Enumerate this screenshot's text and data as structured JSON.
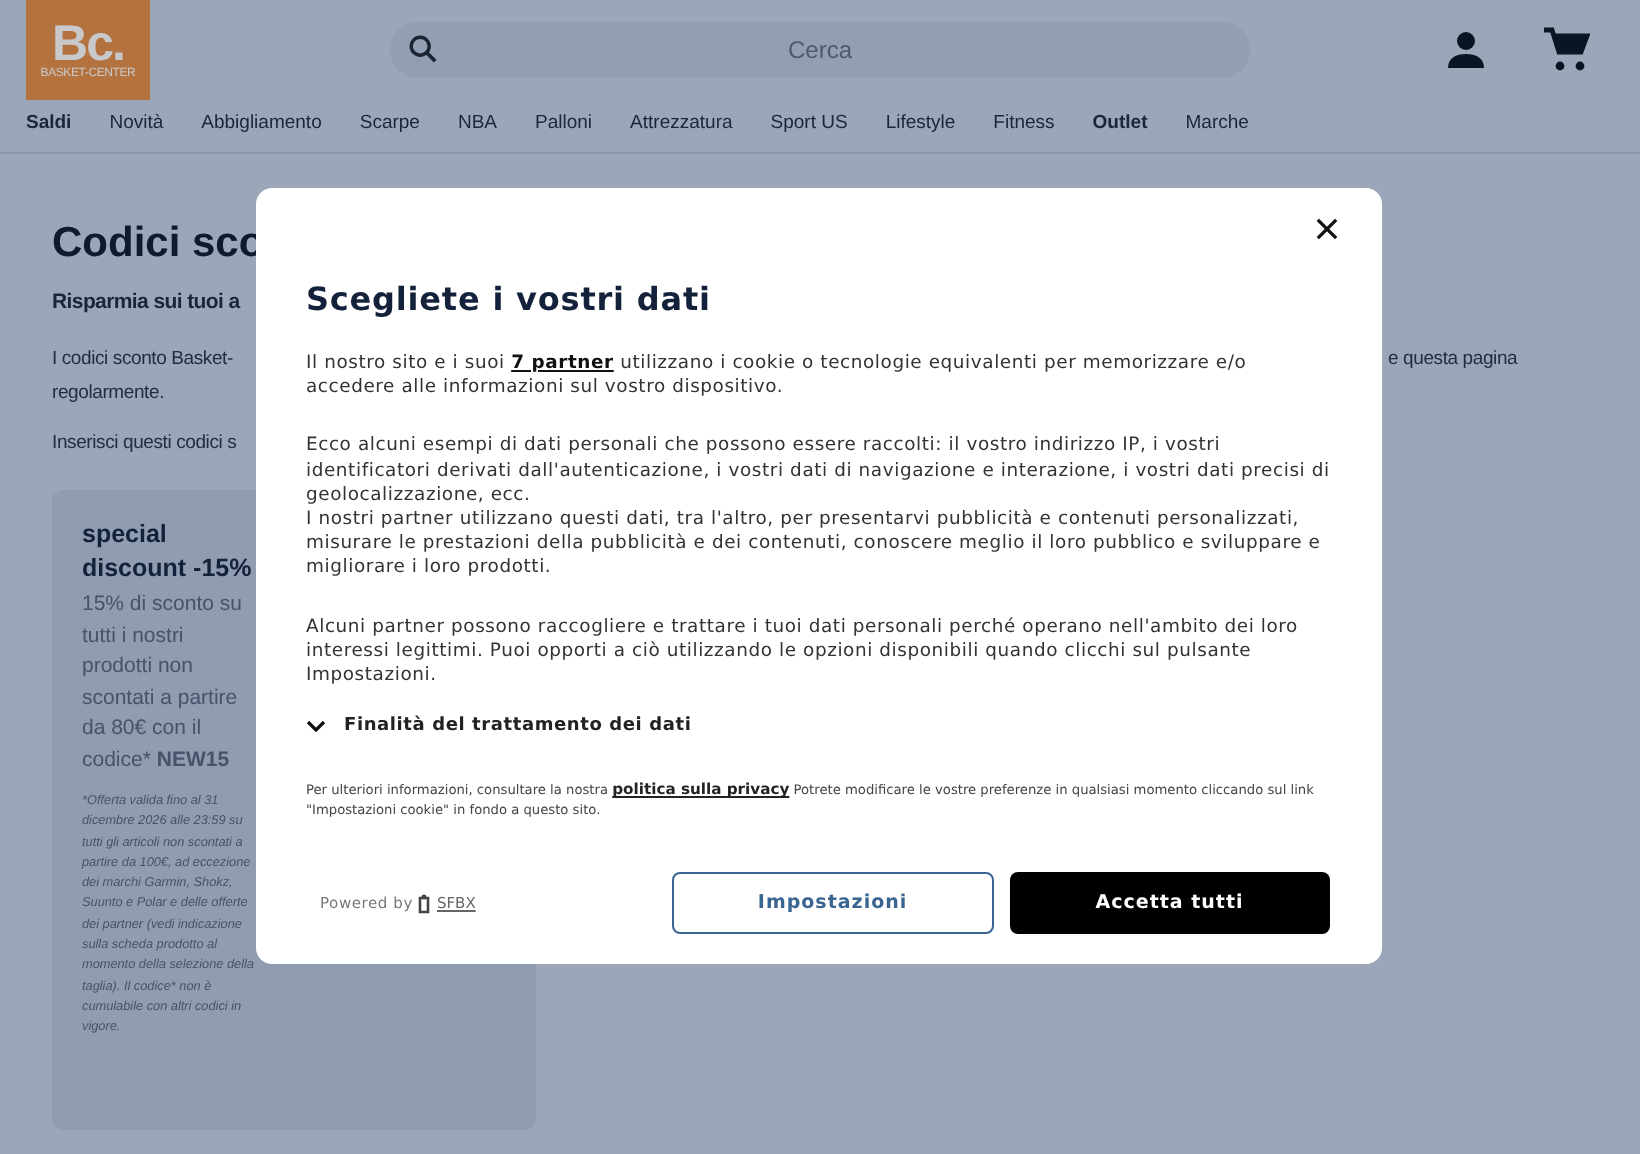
{
  "header": {
    "logo": {
      "mark": "Bc.",
      "name": "BASKET-CENTER"
    },
    "search": {
      "placeholder": "Cerca"
    }
  },
  "nav": [
    {
      "label": "Saldi",
      "emphasized": true
    },
    {
      "label": "Novità",
      "emphasized": false
    },
    {
      "label": "Abbigliamento",
      "emphasized": false
    },
    {
      "label": "Scarpe",
      "emphasized": false
    },
    {
      "label": "NBA",
      "emphasized": false
    },
    {
      "label": "Palloni",
      "emphasized": false
    },
    {
      "label": "Attrezzatura",
      "emphasized": false
    },
    {
      "label": "Sport US",
      "emphasized": false
    },
    {
      "label": "Lifestyle",
      "emphasized": false
    },
    {
      "label": "Fitness",
      "emphasized": false
    },
    {
      "label": "Outlet",
      "emphasized": true
    },
    {
      "label": "Marche",
      "emphasized": false
    }
  ],
  "page": {
    "title": "Codici sco",
    "subtitle": "Risparmia sui tuoi a",
    "intro_left": "I codici sconto Basket-",
    "intro_right": "e questa pagina",
    "intro_line2": "regolarmente.",
    "instruction": "Inserisci questi codici s",
    "card": {
      "title": "special discount -15%",
      "text": "15% di sconto su tutti i nostri prodotti non scontati a partire da 80€ con il codice* **NEW15**",
      "note": "*Offerta valida fino al 31 dicembre 2026 alle 23:59 su tutti gli articoli non scontati a partire da 100€, ad eccezione dei marchi Garmin, Shokz, Suunto e Polar e delle offerte dei partner (vedi indicazione sulla scheda prodotto al momento della selezione della taglia). Il codice* non è cumulabile con altri codici in vigore."
    }
  },
  "consent": {
    "title": "Scegliete i vostri dati",
    "intro": {
      "before": "Il nostro sito e i suoi ",
      "link": "7 partner",
      "after": " utilizzano i cookie o tecnologie equivalenti per memorizzare e/o accedere alle informazioni sul vostro dispositivo."
    },
    "paragraphs": [
      "Ecco alcuni esempi di dati personali che possono essere raccolti: il vostro indirizzo IP, i vostri identificatori derivati dall'autenticazione, i vostri dati di navigazione e interazione, i vostri dati precisi di geolocalizzazione, ecc.",
      "I nostri partner utilizzano questi dati, tra l'altro, per presentarvi pubblicità e contenuti personalizzati, misurare le prestazioni della pubblicità e dei contenuti, conoscere meglio il loro pubblico e sviluppare e migliorare i loro prodotti.",
      "Alcuni partner possono raccogliere e trattare i tuoi dati personali perché operano nell'ambito dei loro interessi legittimi. Puoi opporti a ciò utilizzando le opzioni disponibili quando clicchi sul pulsante Impostazioni."
    ],
    "purposes": {
      "label": "Finalità del trattamento dei dati",
      "expanded": false
    },
    "footnote": {
      "before": "Per ulteriori informazioni, consultare la nostra ",
      "link": "politica sulla privacy",
      "after": " Potrete modificare le vostre preferenze in qualsiasi momento cliccando sul link \"Impostazioni cookie\" in fondo a questo sito."
    },
    "powered_by": "Powered by",
    "brand": "SFBX",
    "buttons": [
      {
        "label": "Impostazioni",
        "kind": "secondary"
      },
      {
        "label": "Accetta tutti",
        "kind": "primary"
      }
    ]
  }
}
